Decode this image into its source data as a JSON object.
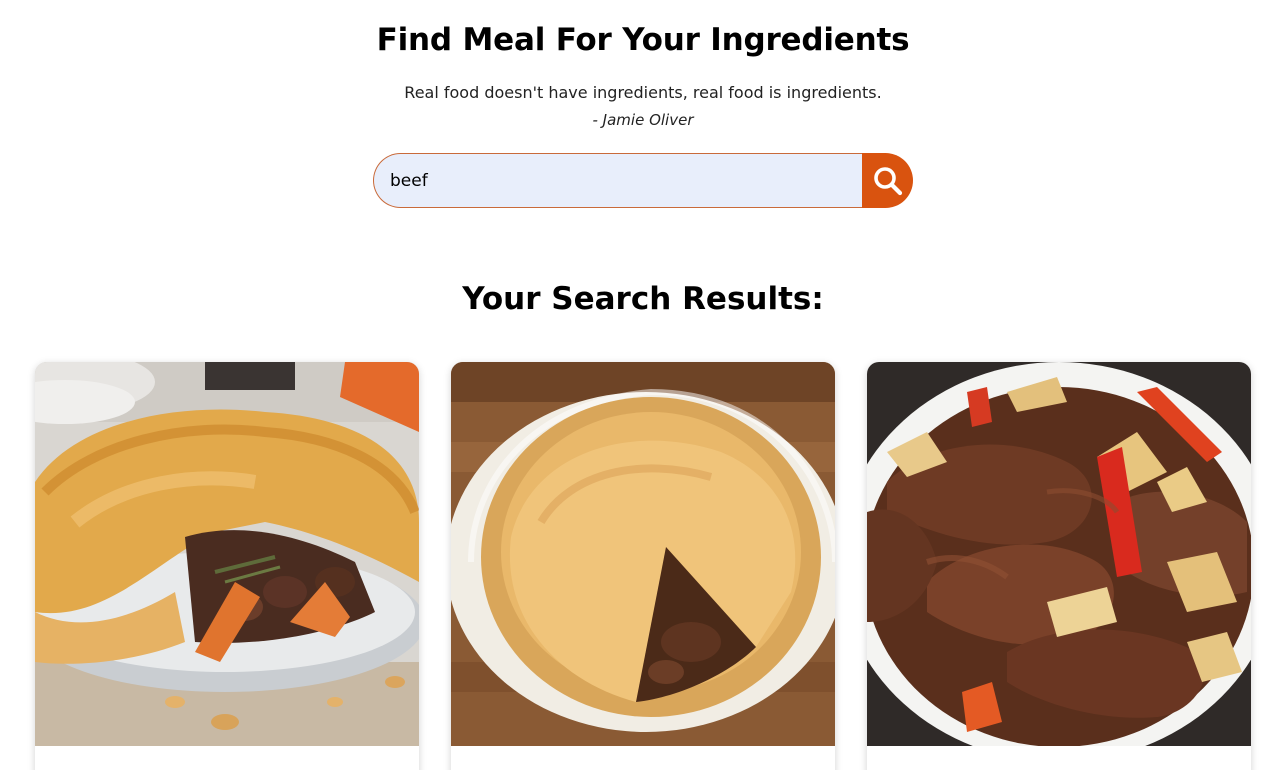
{
  "hero": {
    "title": "Find Meal For Your Ingredients",
    "quote": "Real food doesn't have ingredients, real food is ingredients.",
    "quote_author": "- Jamie Oliver"
  },
  "search": {
    "value": "beef",
    "button_icon": "search-icon"
  },
  "results": {
    "title": "Your Search Results:",
    "cards": [
      {
        "image": "beef-pie-with-carrots-photo"
      },
      {
        "image": "beef-pie-slice-cut-photo"
      },
      {
        "image": "beef-stew-with-potatoes-and-peppers-photo"
      }
    ]
  },
  "colors": {
    "accent": "#d9530f",
    "input_background": "#e8eefb",
    "input_border": "#c96a3a"
  }
}
